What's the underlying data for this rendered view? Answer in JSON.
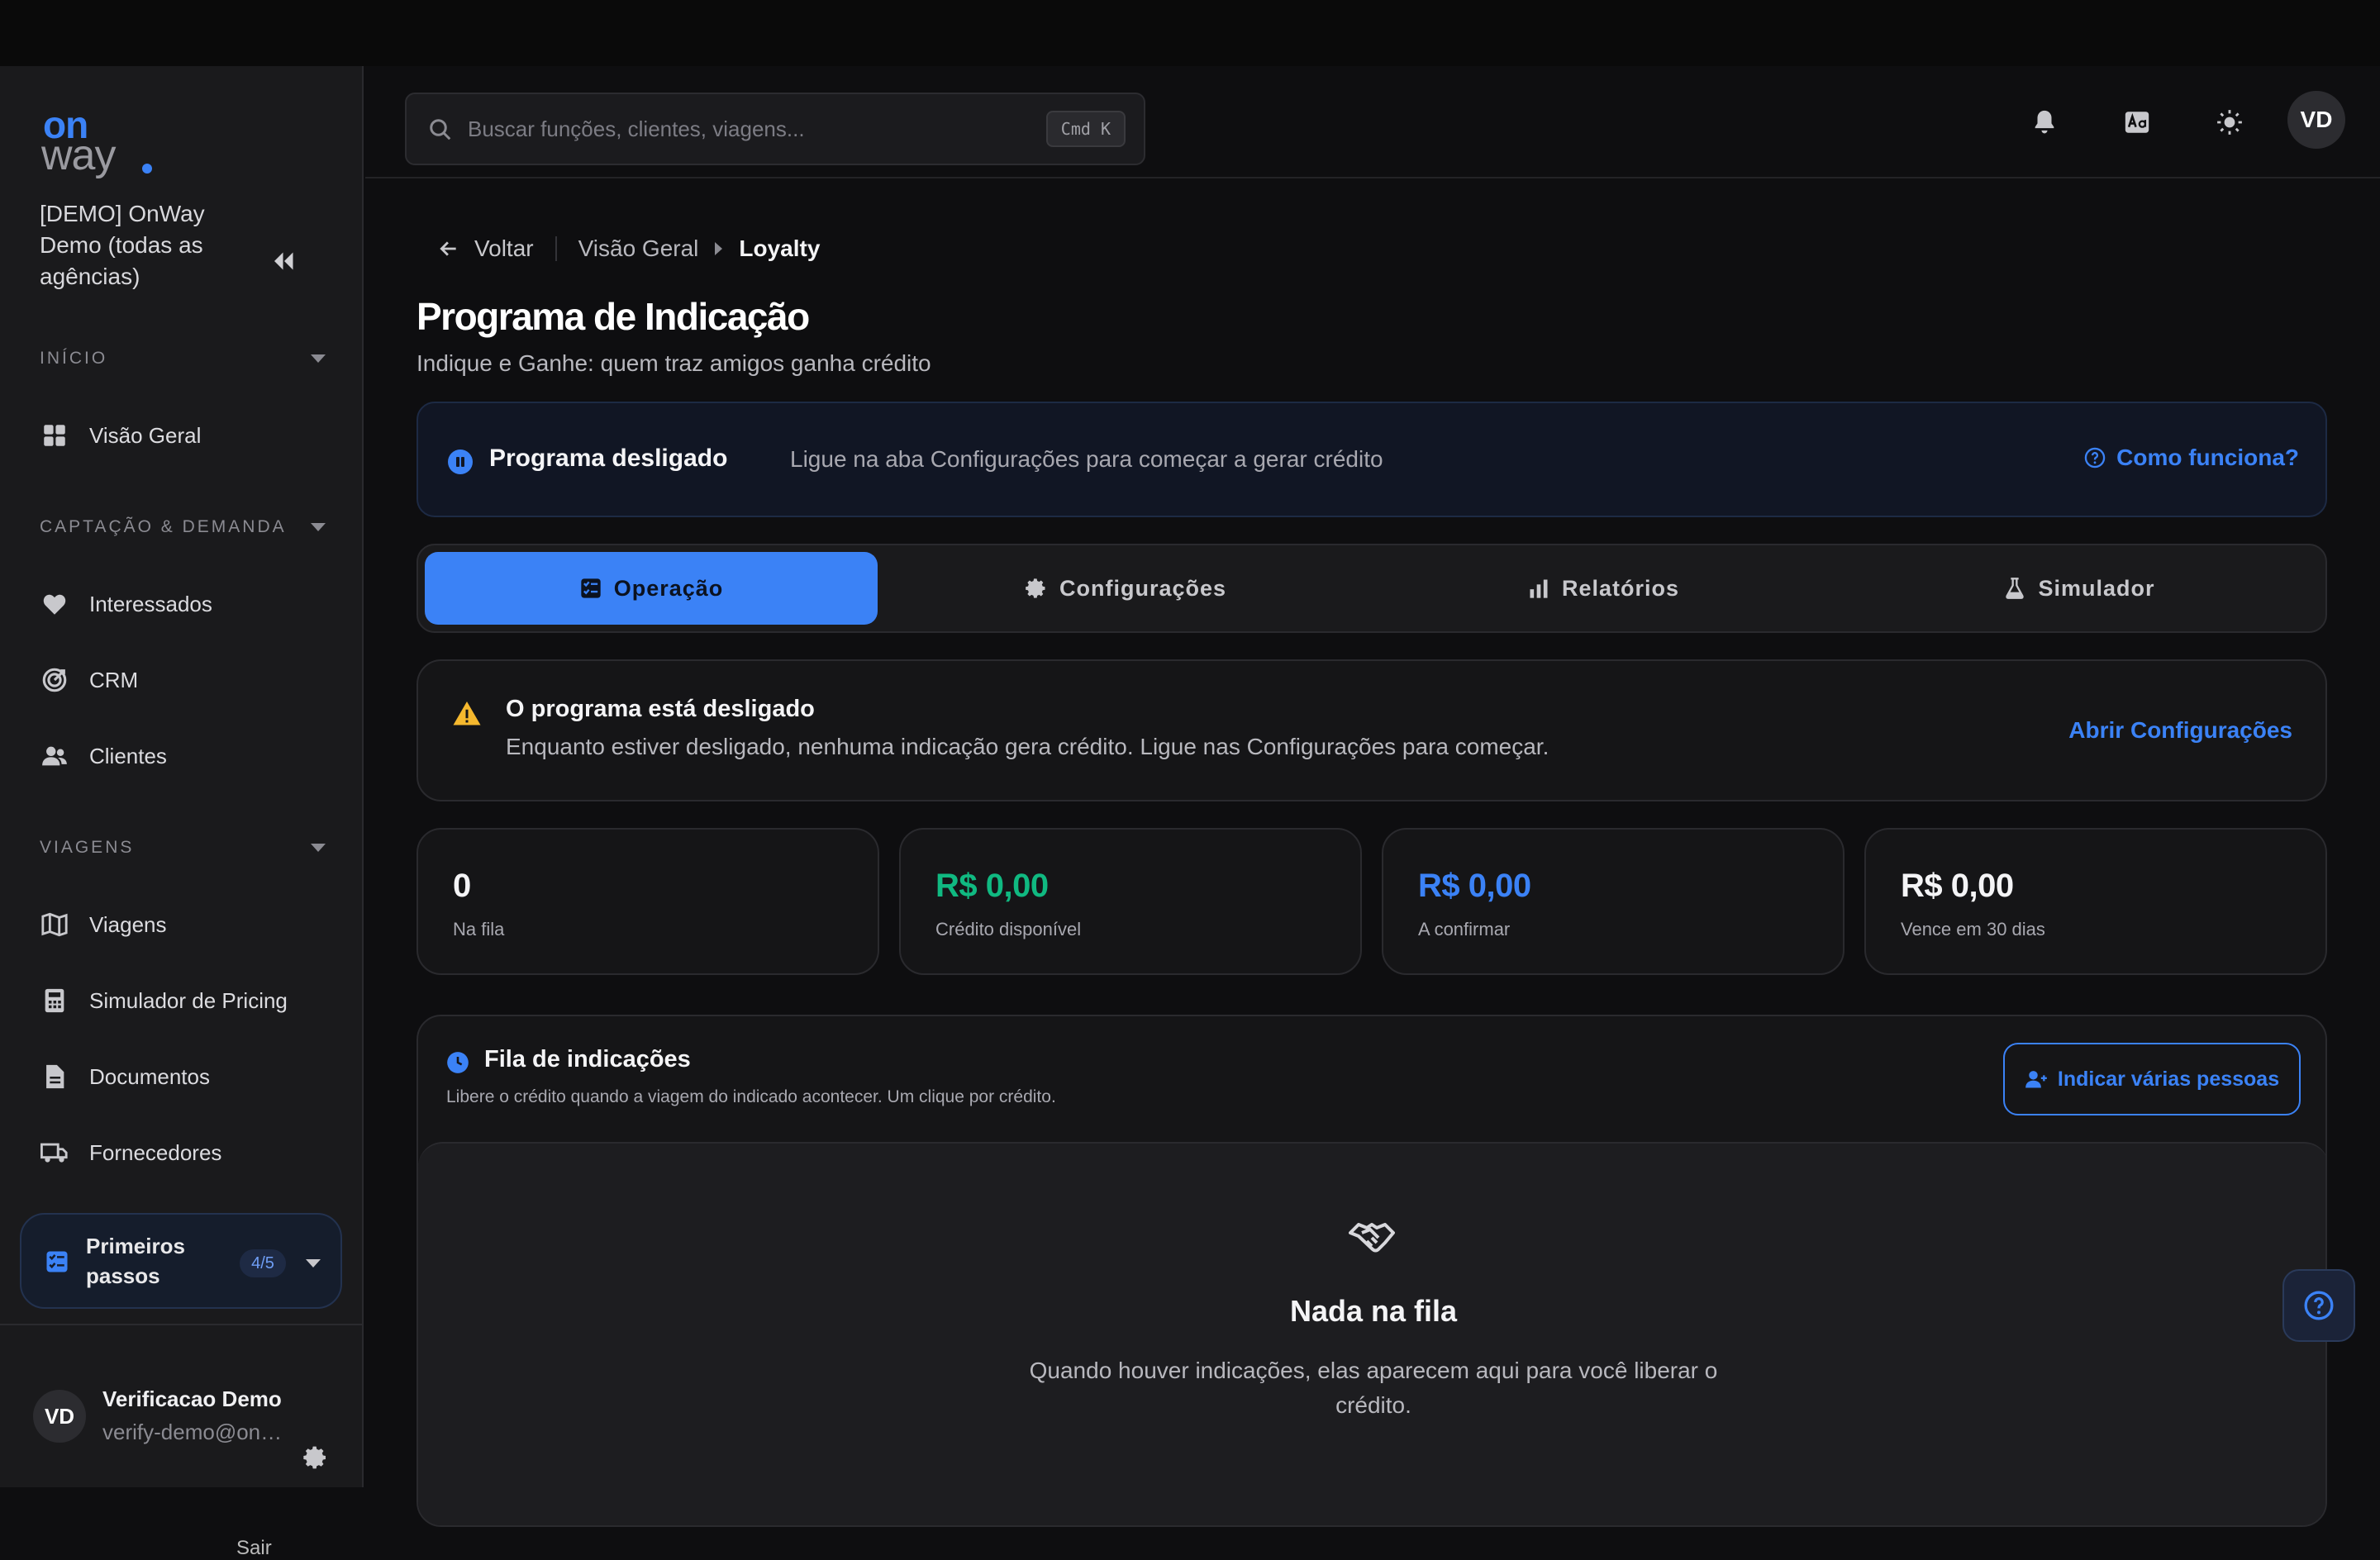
{
  "sidebar": {
    "logo": {
      "top": "on",
      "bottom": "way"
    },
    "org_name": "[DEMO] OnWay Demo (todas as agências)",
    "sections": [
      {
        "title": "INÍCIO",
        "items": [
          {
            "label": "Visão Geral",
            "icon": "grid-icon"
          }
        ]
      },
      {
        "title": "CAPTAÇÃO & DEMANDA",
        "items": [
          {
            "label": "Interessados",
            "icon": "heart-icon"
          },
          {
            "label": "CRM",
            "icon": "target-icon"
          },
          {
            "label": "Clientes",
            "icon": "users-icon"
          }
        ]
      },
      {
        "title": "VIAGENS",
        "items": [
          {
            "label": "Viagens",
            "icon": "map-icon"
          },
          {
            "label": "Simulador de Pricing",
            "icon": "calculator-icon"
          },
          {
            "label": "Documentos",
            "icon": "document-icon"
          },
          {
            "label": "Fornecedores",
            "icon": "truck-icon"
          }
        ]
      }
    ],
    "first_steps": {
      "label": "Primeiros passos",
      "badge": "4/5"
    },
    "user": {
      "initials": "VD",
      "name": "Verificacao Demo",
      "email": "verify-demo@onway.com"
    },
    "logout_label": "Sair"
  },
  "header": {
    "search_placeholder": "Buscar funções, clientes, viagens...",
    "search_shortcut": "Cmd K",
    "avatar_initials": "VD"
  },
  "breadcrumb": {
    "back": "Voltar",
    "parent": "Visão Geral",
    "current": "Loyalty"
  },
  "page": {
    "title": "Programa de Indicação",
    "subtitle": "Indique e Ganhe: quem traz amigos ganha crédito"
  },
  "status_banner": {
    "title": "Programa desligado",
    "text": "Ligue na aba Configurações para começar a gerar crédito",
    "link": "Como funciona?"
  },
  "tabs": [
    {
      "label": "Operação",
      "icon": "checklist-icon",
      "active": true
    },
    {
      "label": "Configurações",
      "icon": "gear-icon",
      "active": false
    },
    {
      "label": "Relatórios",
      "icon": "bar-chart-icon",
      "active": false
    },
    {
      "label": "Simulador",
      "icon": "flask-icon",
      "active": false
    }
  ],
  "warning": {
    "title": "O programa está desligado",
    "text": "Enquanto estiver desligado, nenhuma indicação gera crédito. Ligue nas Configurações para começar.",
    "link": "Abrir Configurações"
  },
  "stats": [
    {
      "value": "0",
      "label": "Na fila",
      "color": "#f4f4f6"
    },
    {
      "value": "R$ 0,00",
      "label": "Crédito disponível",
      "color": "#10b981"
    },
    {
      "value": "R$ 0,00",
      "label": "A confirmar",
      "color": "#3b82f6"
    },
    {
      "value": "R$ 0,00",
      "label": "Vence em 30 dias",
      "color": "#f4f4f6"
    }
  ],
  "queue": {
    "title": "Fila de indicações",
    "subtitle": "Libere o crédito quando a viagem do indicado acontecer. Um clique por crédito.",
    "button": "Indicar várias pessoas",
    "empty_title": "Nada na fila",
    "empty_text": "Quando houver indicações, elas aparecem aqui para você liberar o crédito."
  },
  "colors": {
    "accent": "#3b82f6",
    "success": "#10b981",
    "warning": "#f5b82e"
  }
}
